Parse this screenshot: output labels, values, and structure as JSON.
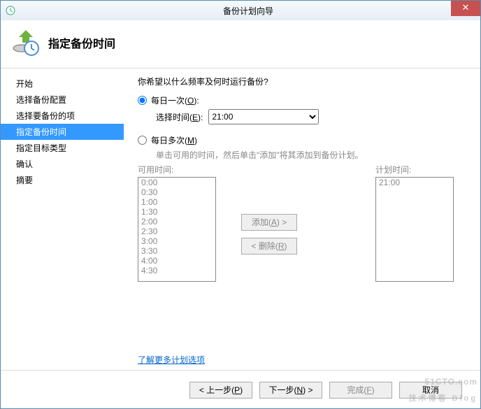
{
  "window_title": "备份计划向导",
  "header": {
    "title": "指定备份时间"
  },
  "sidebar": {
    "items": [
      {
        "label": "开始"
      },
      {
        "label": "选择备份配置"
      },
      {
        "label": "选择要备份的项"
      },
      {
        "label": "指定备份时间"
      },
      {
        "label": "指定目标类型"
      },
      {
        "label": "确认"
      },
      {
        "label": "摘要"
      }
    ],
    "active_index": 3
  },
  "main": {
    "question": "你希望以什么频率及何时运行备份?",
    "option_once": {
      "label_a": "每日一次(",
      "hotkey": "O",
      "label_b": "):"
    },
    "select_time_label_a": "选择时间(",
    "select_time_hotkey": "E",
    "select_time_label_b": "):",
    "selected_time": "21:00",
    "option_multi": {
      "label_a": "每日多次(",
      "hotkey": "M",
      "label_b": ")"
    },
    "multi_hint": "单击可用的时间，然后单击\"添加\"将其添加到备份计划。",
    "available_label": "可用时间:",
    "scheduled_label": "计划时间:",
    "available_times": [
      "0:00",
      "0:30",
      "1:00",
      "1:30",
      "2:00",
      "2:30",
      "3:00",
      "3:30",
      "4:00",
      "4:30"
    ],
    "scheduled_times": [
      "21:00"
    ],
    "add_label_a": "添加(",
    "add_hotkey": "A",
    "add_label_b": ") >",
    "remove_label_a": "< 删除(",
    "remove_hotkey": "R",
    "remove_label_b": ")",
    "more_link": "了解更多计划选项"
  },
  "footer": {
    "prev_a": "< 上一步(",
    "prev_hk": "P",
    "prev_b": ")",
    "next_a": "下一步(",
    "next_hk": "N",
    "next_b": ") >",
    "finish_a": "完成(",
    "finish_hk": "F",
    "finish_b": ")",
    "cancel": "取消"
  },
  "watermark": {
    "line1": "51CTO.com",
    "line2": "技术博客  Blog"
  }
}
